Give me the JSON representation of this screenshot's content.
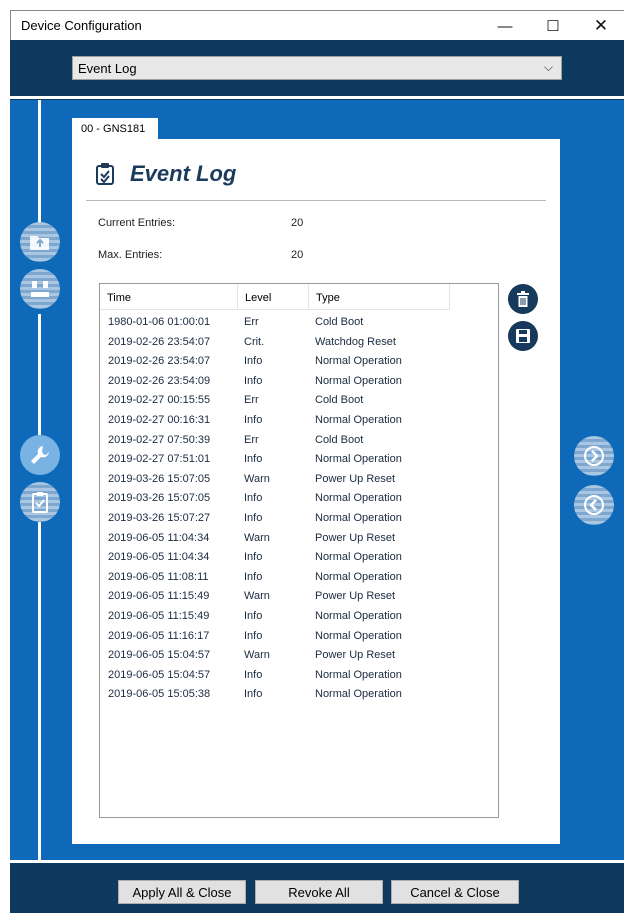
{
  "window": {
    "title": "Device Configuration",
    "min_symbol": "—",
    "max_symbol": "☐",
    "close_symbol": "✕"
  },
  "selector": {
    "value": "Event Log",
    "chevron": "⌵"
  },
  "tab": {
    "label": "00 - GNS181"
  },
  "page": {
    "title": "Event Log",
    "current_entries_label": "Current Entries:",
    "current_entries_value": "20",
    "max_entries_label": "Max. Entries:",
    "max_entries_value": "20"
  },
  "table": {
    "columns": [
      "Time",
      "Level",
      "Type"
    ],
    "rows": [
      {
        "time": "1980-01-06 01:00:01",
        "level": "Err",
        "type": "Cold Boot"
      },
      {
        "time": "2019-02-26 23:54:07",
        "level": "Crit.",
        "type": "Watchdog Reset"
      },
      {
        "time": "2019-02-26 23:54:07",
        "level": "Info",
        "type": "Normal Operation"
      },
      {
        "time": "2019-02-26 23:54:09",
        "level": "Info",
        "type": "Normal Operation"
      },
      {
        "time": "2019-02-27 00:15:55",
        "level": "Err",
        "type": "Cold Boot"
      },
      {
        "time": "2019-02-27 00:16:31",
        "level": "Info",
        "type": "Normal Operation"
      },
      {
        "time": "2019-02-27 07:50:39",
        "level": "Err",
        "type": "Cold Boot"
      },
      {
        "time": "2019-02-27 07:51:01",
        "level": "Info",
        "type": "Normal Operation"
      },
      {
        "time": "2019-03-26 15:07:05",
        "level": "Warn",
        "type": "Power Up Reset"
      },
      {
        "time": "2019-03-26 15:07:05",
        "level": "Info",
        "type": "Normal Operation"
      },
      {
        "time": "2019-03-26 15:07:27",
        "level": "Info",
        "type": "Normal Operation"
      },
      {
        "time": "2019-06-05 11:04:34",
        "level": "Warn",
        "type": "Power Up Reset"
      },
      {
        "time": "2019-06-05 11:04:34",
        "level": "Info",
        "type": "Normal Operation"
      },
      {
        "time": "2019-06-05 11:08:11",
        "level": "Info",
        "type": "Normal Operation"
      },
      {
        "time": "2019-06-05 11:15:49",
        "level": "Warn",
        "type": "Power Up Reset"
      },
      {
        "time": "2019-06-05 11:15:49",
        "level": "Info",
        "type": "Normal Operation"
      },
      {
        "time": "2019-06-05 11:16:17",
        "level": "Info",
        "type": "Normal Operation"
      },
      {
        "time": "2019-06-05 15:04:57",
        "level": "Warn",
        "type": "Power Up Reset"
      },
      {
        "time": "2019-06-05 15:04:57",
        "level": "Info",
        "type": "Normal Operation"
      },
      {
        "time": "2019-06-05 15:05:38",
        "level": "Info",
        "type": "Normal Operation"
      }
    ]
  },
  "sidebar_left": [
    {
      "icon": "upload-folder-icon",
      "active": false
    },
    {
      "icon": "network-icon",
      "active": false
    },
    {
      "icon": "wrench-icon",
      "active": true
    },
    {
      "icon": "clipboard-check-icon",
      "active": false
    }
  ],
  "sidebar_right": [
    {
      "icon": "arrow-right-circle-icon"
    },
    {
      "icon": "arrow-left-circle-icon"
    }
  ],
  "actions": {
    "apply_all_close": "Apply All & Close",
    "revoke_all": "Revoke All",
    "cancel_close": "Cancel & Close"
  },
  "colors": {
    "frame_dark": "#0f3a5f",
    "content_blue": "#0e6ab8",
    "heading_text": "#1c3a5c",
    "round_button": "#16395c"
  }
}
